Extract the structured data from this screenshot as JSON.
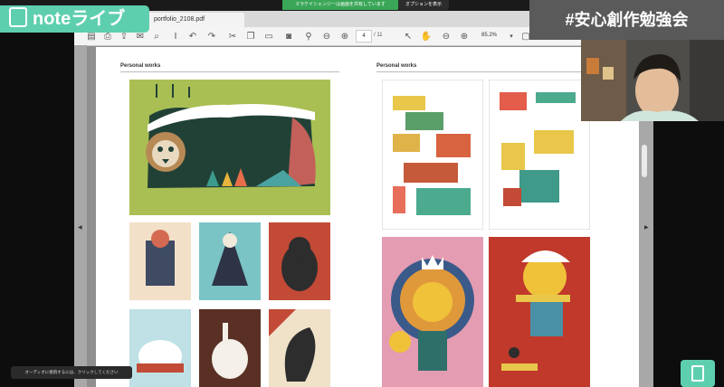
{
  "overlay": {
    "logo_text": "noteライブ",
    "hashtag": "#安心創作勉強会",
    "caption": "オーディオに接続するには、クリックしてください"
  },
  "screenshare": {
    "banner_text": "マラケイシェンジーは画面を共有しています",
    "options_button": "オプションを表示"
  },
  "pdf": {
    "tab_title": "portfolio_2108.pdf",
    "current_page": "4",
    "total_pages": "/ 11",
    "zoom": "85.2%",
    "left_section_title": "Personal works",
    "right_section_title": "Personal works"
  },
  "colors": {
    "brand_green": "#5ecfae",
    "share_green": "#3aa657"
  }
}
